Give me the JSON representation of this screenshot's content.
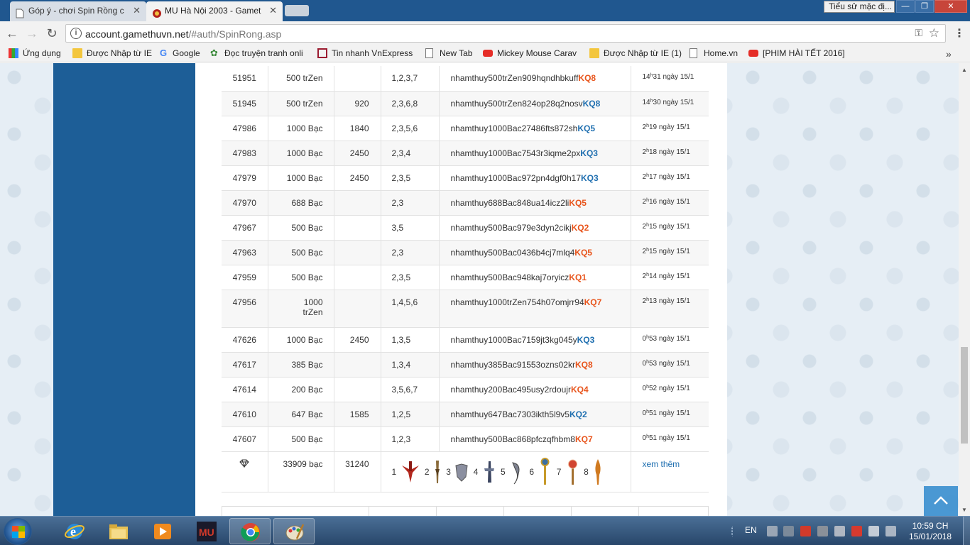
{
  "browser": {
    "tabs": [
      {
        "title": "Góp ý - chơi Spin Rồng c",
        "active": false
      },
      {
        "title": "MU Hà Nội 2003 - Gamet",
        "active": true
      }
    ],
    "tooltip": "Tiểu sử mặc đị...",
    "url_host": "account.gamethuvn.net",
    "url_path": "/#auth/SpinRong.asp"
  },
  "bookmarks": [
    {
      "label": "Ứng dụng",
      "icon": "apps-icon"
    },
    {
      "label": "Được Nhập từ IE",
      "icon": "folder-icon"
    },
    {
      "label": "Google",
      "icon": "google-icon"
    },
    {
      "label": "Đọc truyện tranh onli",
      "icon": "leaf-icon"
    },
    {
      "label": "Tin nhanh VnExpress",
      "icon": "vnexpress-icon"
    },
    {
      "label": "New Tab",
      "icon": "page-icon"
    },
    {
      "label": "Mickey Mouse Carav",
      "icon": "youtube-icon"
    },
    {
      "label": "Được Nhập từ IE (1)",
      "icon": "folder-icon"
    },
    {
      "label": "Home.vn",
      "icon": "page-icon"
    },
    {
      "label": "[PHIM HÀI TẾT 2016]",
      "icon": "youtube-icon"
    }
  ],
  "table": {
    "rows": [
      {
        "id": "51951",
        "bet": "500 trZen",
        "win": "",
        "nums": "1,2,3,7",
        "code": "nhamthuy500trZen909hqndhbkuff",
        "kq": "KQ8",
        "kq_color": "orange",
        "hour": "14",
        "min": "31",
        "date": "ngày 15/1"
      },
      {
        "id": "51945",
        "bet": "500 trZen",
        "win": "920",
        "nums": "2,3,6,8",
        "code": "nhamthuy500trZen824op28q2nosv",
        "kq": "KQ8",
        "kq_color": "blue",
        "hour": "14",
        "min": "30",
        "date": "ngày 15/1"
      },
      {
        "id": "47986",
        "bet": "1000 Bạc",
        "win": "1840",
        "nums": "2,3,5,6",
        "code": "nhamthuy1000Bac27486fts872sh",
        "kq": "KQ5",
        "kq_color": "blue",
        "hour": "2",
        "min": "19",
        "date": "ngày 15/1"
      },
      {
        "id": "47983",
        "bet": "1000 Bạc",
        "win": "2450",
        "nums": "2,3,4",
        "code": "nhamthuy1000Bac7543r3iqme2px",
        "kq": "KQ3",
        "kq_color": "blue",
        "hour": "2",
        "min": "18",
        "date": "ngày 15/1"
      },
      {
        "id": "47979",
        "bet": "1000 Bạc",
        "win": "2450",
        "nums": "2,3,5",
        "code": "nhamthuy1000Bac972pn4dgf0h17",
        "kq": "KQ3",
        "kq_color": "blue",
        "hour": "2",
        "min": "17",
        "date": "ngày 15/1"
      },
      {
        "id": "47970",
        "bet": "688 Bạc",
        "win": "",
        "nums": "2,3",
        "code": "nhamthuy688Bac848ua14icz2li",
        "kq": "KQ5",
        "kq_color": "orange",
        "hour": "2",
        "min": "16",
        "date": "ngày 15/1"
      },
      {
        "id": "47967",
        "bet": "500 Bạc",
        "win": "",
        "nums": "3,5",
        "code": "nhamthuy500Bac979e3dyn2cikj",
        "kq": "KQ2",
        "kq_color": "orange",
        "hour": "2",
        "min": "15",
        "date": "ngày 15/1"
      },
      {
        "id": "47963",
        "bet": "500 Bạc",
        "win": "",
        "nums": "2,3",
        "code": "nhamthuy500Bac0436b4cj7mlq4",
        "kq": "KQ5",
        "kq_color": "orange",
        "hour": "2",
        "min": "15",
        "date": "ngày 15/1"
      },
      {
        "id": "47959",
        "bet": "500 Bạc",
        "win": "",
        "nums": "2,3,5",
        "code": "nhamthuy500Bac948kaj7oryicz",
        "kq": "KQ1",
        "kq_color": "orange",
        "hour": "2",
        "min": "14",
        "date": "ngày 15/1"
      },
      {
        "id": "47956",
        "bet": "1000 trZen",
        "win": "",
        "nums": "1,4,5,6",
        "code": "nhamthuy1000trZen754h07omjrr94",
        "kq": "KQ7",
        "kq_color": "orange",
        "hour": "2",
        "min": "13",
        "date": "ngày 15/1",
        "tall": true
      },
      {
        "id": "47626",
        "bet": "1000 Bạc",
        "win": "2450",
        "nums": "1,3,5",
        "code": "nhamthuy1000Bac7159jt3kg045y",
        "kq": "KQ3",
        "kq_color": "blue",
        "hour": "0",
        "min": "53",
        "date": "ngày 15/1"
      },
      {
        "id": "47617",
        "bet": "385 Bạc",
        "win": "",
        "nums": "1,3,4",
        "code": "nhamthuy385Bac91553ozns02kr",
        "kq": "KQ8",
        "kq_color": "orange",
        "hour": "0",
        "min": "53",
        "date": "ngày 15/1"
      },
      {
        "id": "47614",
        "bet": "200 Bạc",
        "win": "",
        "nums": "3,5,6,7",
        "code": "nhamthuy200Bac495usy2rdoujr",
        "kq": "KQ4",
        "kq_color": "orange",
        "hour": "0",
        "min": "52",
        "date": "ngày 15/1"
      },
      {
        "id": "47610",
        "bet": "647 Bạc",
        "win": "1585",
        "nums": "1,2,5",
        "code": "nhamthuy647Bac7303ikth5l9v5",
        "kq": "KQ2",
        "kq_color": "blue",
        "hour": "0",
        "min": "51",
        "date": "ngày 15/1"
      },
      {
        "id": "47607",
        "bet": "500 Bạc",
        "win": "",
        "nums": "1,2,3",
        "code": "nhamthuy500Bac868pfczqfhbm8",
        "kq": "KQ7",
        "kq_color": "orange",
        "hour": "0",
        "min": "51",
        "date": "ngày 15/1"
      }
    ],
    "summary": {
      "total_bet": "33909 bạc",
      "total_win": "31240",
      "weapons": [
        "1",
        "2",
        "3",
        "4",
        "5",
        "6",
        "7",
        "8"
      ],
      "more_link": "xem thêm"
    }
  },
  "taskbar": {
    "lang": "EN",
    "time": "10:59 CH",
    "date": "15/01/2018"
  },
  "colors": {
    "sidebar": "#1d5e97",
    "kq_orange": "#e8541b",
    "kq_blue": "#1f6fb0",
    "scrolltop": "#3a8fd0"
  }
}
